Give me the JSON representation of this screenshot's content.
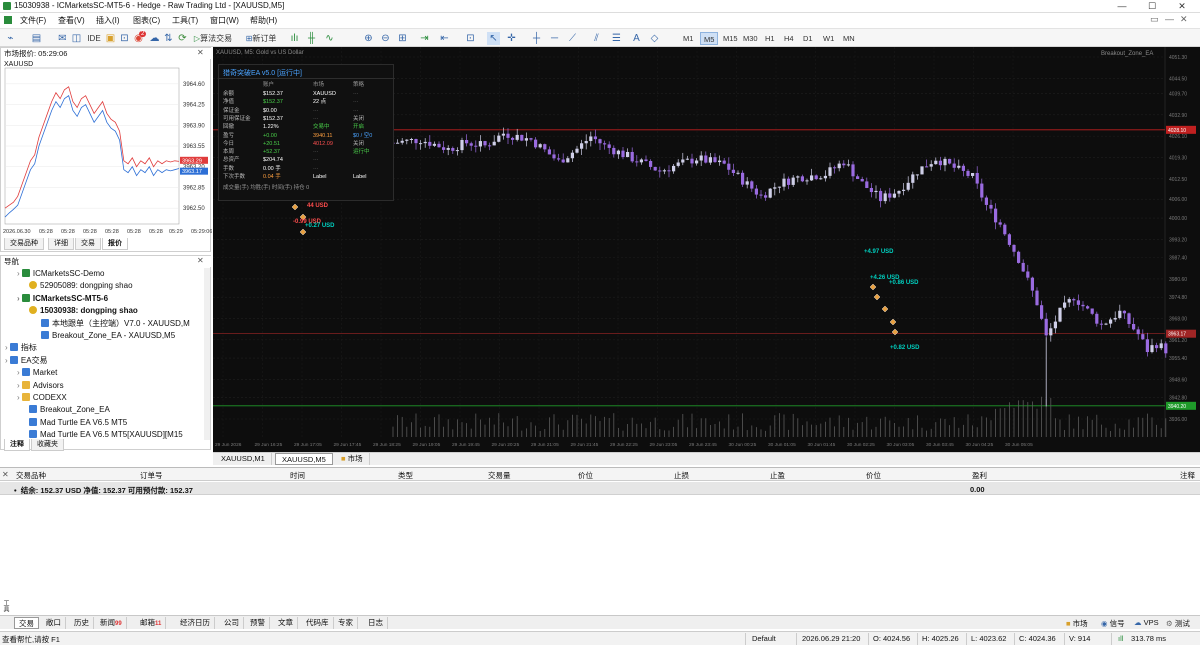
{
  "window": {
    "title": "15030938 - ICMarketsSC-MT5-6 - Hedge - Raw Trading Ltd - [XAUUSD,M5]",
    "min": "—",
    "max": "☐",
    "close": "✕"
  },
  "menu": [
    "文件(F)",
    "查看(V)",
    "插入(I)",
    "图表(C)",
    "工具(T)",
    "窗口(W)",
    "帮助(H)"
  ],
  "toolbar": {
    "ide": "IDE",
    "algo_trading": "算法交易",
    "new_order": "新订单",
    "badge_count": "2",
    "timeframes": [
      "M1",
      "M5",
      "M15",
      "M30",
      "H1",
      "H4",
      "D1",
      "W1",
      "MN"
    ],
    "active_tf": "M5"
  },
  "market_watch": {
    "title": "市场报价: 05:29:06",
    "symbol": "XAUUSD",
    "price_labels": [
      "3964.60",
      "3964.25",
      "3963.90",
      "3963.55",
      "3963.20",
      "3962.85",
      "3962.50"
    ],
    "bid_label": "3963.29",
    "ask_label": "3963.17",
    "time_labels": [
      "2026.06.30",
      "05:28",
      "05:28",
      "05:28",
      "05:28",
      "05:28",
      "05:28",
      "05:29",
      "05:29:06"
    ],
    "tabs": [
      "交易品种",
      "详细",
      "交易",
      "报价"
    ],
    "active_tab": "报价",
    "ask_line": [
      3962.5,
      3962.55,
      3962.6,
      3962.7,
      3962.9,
      3963.1,
      3963.3,
      3963.4,
      3963.7,
      3963.9,
      3964.1,
      3964.3,
      3964.45,
      3964.35,
      3964.5,
      3964.55,
      3964.3,
      3964.2,
      3964.35,
      3964.4,
      3964.25,
      3964.1,
      3964.2,
      3964.3,
      3964.1,
      3964.0,
      3963.95,
      3963.8,
      3963.3,
      3963.25,
      3963.35,
      3963.2,
      3963.3,
      3963.25,
      3963.35,
      3963.2,
      3963.3,
      3963.25,
      3963.3,
      3963.28,
      3963.3,
      3963.29
    ],
    "bid_line": [
      3962.35,
      3962.42,
      3962.48,
      3962.55,
      3962.75,
      3962.95,
      3963.15,
      3963.25,
      3963.55,
      3963.75,
      3963.95,
      3964.15,
      3964.3,
      3964.2,
      3964.35,
      3964.4,
      3964.15,
      3964.05,
      3964.2,
      3964.25,
      3964.1,
      3963.95,
      3964.05,
      3964.15,
      3963.95,
      3963.85,
      3963.8,
      3963.65,
      3963.15,
      3963.1,
      3963.2,
      3963.05,
      3963.15,
      3963.1,
      3963.2,
      3963.05,
      3963.15,
      3963.1,
      3963.15,
      3963.13,
      3963.15,
      3963.17
    ]
  },
  "navigator": {
    "title": "导航",
    "items": [
      {
        "label": "ICMarketsSC-Demo",
        "level": 1,
        "icon": "account-server-icon",
        "bold": false
      },
      {
        "label": "52905089: dongping shao",
        "level": 2,
        "icon": "user-icon",
        "bold": false
      },
      {
        "label": "ICMarketsSC-MT5-6",
        "level": 1,
        "icon": "account-server-icon",
        "bold": true
      },
      {
        "label": "15030938: dongping shao",
        "level": 2,
        "icon": "user-icon",
        "bold": true
      },
      {
        "label": "本地跟单（主控端）V7.0 - XAUUSD,M",
        "level": 3,
        "icon": "ea-icon",
        "bold": false
      },
      {
        "label": "Breakout_Zone_EA - XAUUSD,M5",
        "level": 3,
        "icon": "ea-icon",
        "bold": false
      },
      {
        "label": "指标",
        "level": 0,
        "icon": "indicator-icon",
        "bold": false
      },
      {
        "label": "EA交易",
        "level": 0,
        "icon": "ea-icon",
        "bold": false
      },
      {
        "label": "Market",
        "level": 1,
        "icon": "ea-icon",
        "bold": false
      },
      {
        "label": "Advisors",
        "level": 1,
        "icon": "folder-icon",
        "bold": false
      },
      {
        "label": "CODEXX",
        "level": 1,
        "icon": "folder-icon",
        "bold": false
      },
      {
        "label": "Breakout_Zone_EA",
        "level": 2,
        "icon": "ea-icon",
        "bold": false
      },
      {
        "label": "Mad Turtle EA V6.5 MT5",
        "level": 2,
        "icon": "ea-icon",
        "bold": false
      },
      {
        "label": "Mad Turtle EA V6.5 MT5[XAUUSD][M15",
        "level": 2,
        "icon": "ea-icon",
        "bold": false
      }
    ],
    "tabs": [
      "注释",
      "收藏夹"
    ],
    "active_tab": "注释"
  },
  "chart": {
    "symbol_info": "XAUUSD, M5:  Gold vs US Dollar",
    "ea_label": "Breakout_Zone_EA",
    "price_labels": [
      "4051.30",
      "4044.50",
      "4039.70",
      "4032.90",
      "4026.10",
      "4019.30",
      "4012.50",
      "4006.00",
      "4000.00",
      "3993.20",
      "3987.40",
      "3980.60",
      "3974.80",
      "3968.00",
      "3961.20",
      "3955.40",
      "3948.60",
      "3942.80",
      "3936.00"
    ],
    "red_line_label": "4028.10",
    "mid_line_label": "3963.17",
    "green_line_label": "3940.20",
    "time_labels": [
      "29 Jun 2026",
      "29 Jun 16:25",
      "29 Jun 17:05",
      "29 Jun 17:45",
      "29 Jun 18:25",
      "29 Jun 19:05",
      "29 Jun 19:45",
      "29 Jun 20:25",
      "29 Jun 21:05",
      "29 Jun 21:45",
      "29 Jun 22:25",
      "29 Jun 23:05",
      "29 Jun 23:45",
      "30 Jun 00:25",
      "30 Jun 01:05",
      "30 Jun 01:45",
      "30 Jun 02:25",
      "30 Jun 03:05",
      "30 Jun 03:45",
      "30 Jun 04:25",
      "30 Jun 05:05"
    ],
    "trade_labels": [
      {
        "text": "44 USD",
        "color": "#ff4d4d"
      },
      {
        "text": "-0.99 USD",
        "color": "#ff4d4d"
      },
      {
        "text": "+0.27 USD",
        "color": "#00d0c0"
      },
      {
        "text": "+4.97 USD",
        "color": "#00d0c0"
      },
      {
        "text": "+4.26 USD",
        "color": "#00d0c0"
      },
      {
        "text": "+0.86 USD",
        "color": "#00d0c0"
      },
      {
        "text": "+0.82 USD",
        "color": "#00d0c0"
      }
    ],
    "tabs": [
      "XAUUSD,M1",
      "XAUUSD,M5",
      "市场"
    ],
    "active_tab": "XAUUSD,M5"
  },
  "ea_panel": {
    "title": "猎奇突破EA  v5.0  [运行中]",
    "headers": [
      "账户",
      "市场",
      "策略"
    ],
    "rows": [
      [
        "余额",
        "$152.37",
        "XAUUSD",
        "···"
      ],
      [
        "净值",
        "$152.37",
        "22 点",
        "···"
      ],
      [
        "保证金",
        "$0.00",
        "···",
        "···"
      ],
      [
        "可用保证金",
        "$152.37",
        "···",
        "关闭"
      ],
      [
        "回撤",
        "1.22%",
        "交易中",
        "开启"
      ],
      [
        "盈亏",
        "+0.00",
        "3940.11",
        "$0 / 空0"
      ],
      [
        "今日",
        "+20.51",
        "4012.09",
        "关闭"
      ],
      [
        "本周",
        "+52.37",
        "···",
        "运行中"
      ],
      [
        "总资产",
        "$204.74",
        "···",
        ""
      ],
      [
        "手数",
        "0.00 手",
        "···",
        ""
      ],
      [
        "下次手数",
        "0.04 手",
        "Label",
        "Label"
      ]
    ],
    "footer": "成交量(手)  均胜(手)  时间(手)  持仓 0"
  },
  "terminal": {
    "columns": [
      "交易品种",
      "订单号",
      "时间",
      "类型",
      "交易量",
      "价位",
      "止损",
      "止盈",
      "价位",
      "盈利",
      "注释"
    ],
    "summary": "结余: 152.37 USD  净值: 152.37  可用预付款: 152.37",
    "profit_total": "0.00",
    "side_label": "工具箱"
  },
  "terminal_tabs": [
    {
      "label": "交易",
      "badge": ""
    },
    {
      "label": "敞口",
      "badge": ""
    },
    {
      "label": "历史",
      "badge": ""
    },
    {
      "label": "新闻",
      "badge": "99"
    },
    {
      "label": "邮箱",
      "badge": "11"
    },
    {
      "label": "经济日历",
      "badge": ""
    },
    {
      "label": "公司",
      "badge": ""
    },
    {
      "label": "预警",
      "badge": ""
    },
    {
      "label": "文章",
      "badge": ""
    },
    {
      "label": "代码库",
      "badge": ""
    },
    {
      "label": "专家",
      "badge": ""
    },
    {
      "label": "日志",
      "badge": ""
    }
  ],
  "terminal_right": {
    "market": "市场",
    "signal": "信号",
    "vps": "VPS",
    "tester": "测试"
  },
  "status": {
    "help": "查看帮忙,请按 F1",
    "profile": "Default",
    "datetime": "2026.06.29 21:20",
    "open": "O: 4024.56",
    "high": "H: 4025.26",
    "low": "L: 4023.62",
    "close": "C: 4024.36",
    "volume": "V: 914",
    "ping": "313.78 ms"
  }
}
